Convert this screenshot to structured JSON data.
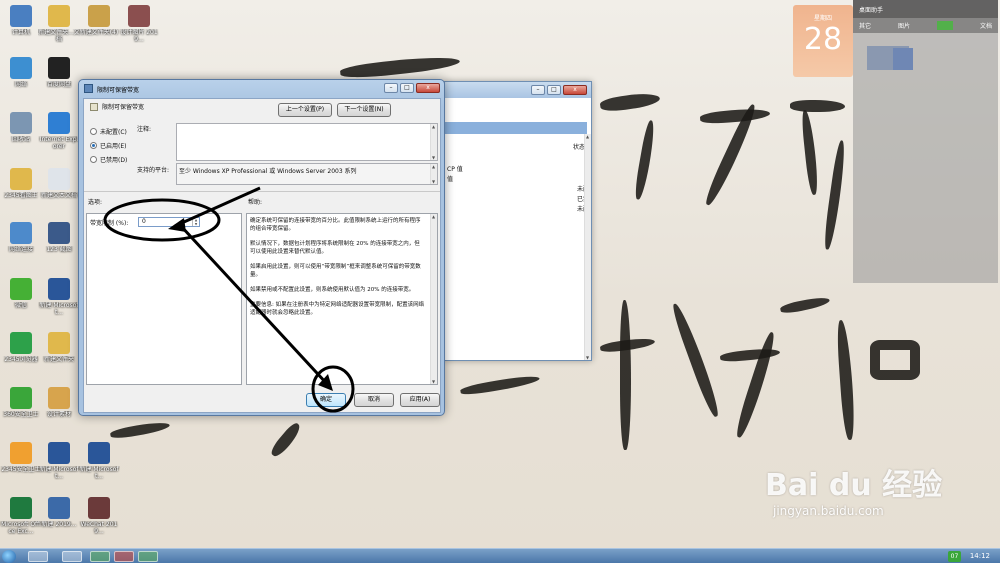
{
  "desktop": {
    "icons": [
      {
        "label": "计算机",
        "icon": "computer-icon",
        "color": "#4a7fc1"
      },
      {
        "label": "新建文件夹...文档",
        "icon": "folder-icon",
        "color": "#e0b84c"
      },
      {
        "label": "新建文件夹(4)",
        "icon": "folder-icon",
        "color": "#caa14a"
      },
      {
        "label": "设计图片 2019...",
        "icon": "image-icon",
        "color": "#8b4f4f"
      },
      {
        "label": "网络",
        "icon": "network-icon",
        "color": "#3d8fd1"
      },
      {
        "label": "百度网盘",
        "icon": "app-icon",
        "color": "#222222"
      },
      {
        "label": "回收站",
        "icon": "recycle-bin-icon",
        "color": "#7c96b2"
      },
      {
        "label": "Internet Explorer",
        "icon": "ie-icon",
        "color": "#2f7fd3"
      },
      {
        "label": "2345看图王",
        "icon": "folder-icon",
        "color": "#e0b84c"
      },
      {
        "label": "新建文本文档",
        "icon": "text-file-icon",
        "color": "#dfe4ea"
      },
      {
        "label": "网络连接",
        "icon": "network-icon",
        "color": "#4d8acb"
      },
      {
        "label": "123 截图",
        "icon": "image-icon",
        "color": "#3b5a8a"
      },
      {
        "label": "微信",
        "icon": "wechat-icon",
        "color": "#45b035"
      },
      {
        "label": "新建 Microsoft...",
        "icon": "word-icon",
        "color": "#2a5699"
      },
      {
        "label": "2345浏览器",
        "icon": "browser-icon",
        "color": "#2da14a"
      },
      {
        "label": "新建文件夹",
        "icon": "folder-icon",
        "color": "#e0b84c"
      },
      {
        "label": "360安全卫士",
        "icon": "shield-icon",
        "color": "#3aa63a"
      },
      {
        "label": "设计素材",
        "icon": "folder-icon",
        "color": "#d7a44d"
      },
      {
        "label": "2345安全卫士",
        "icon": "app-icon",
        "color": "#f0a030"
      },
      {
        "label": "新建 Microsoft...",
        "icon": "word-icon",
        "color": "#2a5699"
      },
      {
        "label": "新建 Microsoft...",
        "icon": "word-icon",
        "color": "#2a5699"
      },
      {
        "label": "Microsoft Office Exc...",
        "icon": "excel-icon",
        "color": "#1f7a3f"
      },
      {
        "label": "新建 2019...",
        "icon": "word-icon",
        "color": "#3c6aa8"
      },
      {
        "label": "WeChat 2019...",
        "icon": "image-icon",
        "color": "#6b3a3a"
      }
    ]
  },
  "calendar": {
    "month": "星期四",
    "day": "28"
  },
  "assistant": {
    "title": "桌面助手",
    "tabs": [
      "其它",
      "图片",
      "",
      "文档"
    ],
    "active_tab": "图片"
  },
  "taskbar": {
    "clock": "14:12",
    "tray_badge": "07"
  },
  "background_window": {
    "rows": [
      {
        "left": "CP 值",
        "right": ""
      },
      {
        "left": "值",
        "right": ""
      },
      {
        "left": "",
        "right": "未配"
      },
      {
        "left": "",
        "right": "已禁"
      },
      {
        "left": "",
        "right": "未配"
      }
    ],
    "header_right": "状态"
  },
  "dialog": {
    "title": "限制可保留带宽",
    "subtitle": "限制可保留带宽",
    "prev_button": "上一个设置(P)",
    "next_button": "下一个设置(N)",
    "radios": [
      "未配置(C)",
      "已启用(E)",
      "已禁用(D)"
    ],
    "selected_radio": 1,
    "comment_label": "注释:",
    "platform_label": "支持的平台:",
    "platform_value": "至少 Windows XP Professional 或 Windows Server 2003 系列",
    "options_label": "选项:",
    "help_label": "帮助:",
    "bandwidth_label": "带宽限制 (%):",
    "bandwidth_value": "0",
    "help_paragraphs": [
      "确定系统可保留的连接带宽的百分比。此值限制系统上运行的所有程序的组合带宽保留。",
      "默认情况下，数据包计划程序将系统限制在 20% 的连接带宽之内，但可以使用此设置来替代默认值。",
      "如果启用此设置，则可以使用“带宽限制”框来调整系统可保留的带宽数量。",
      "如果禁用或不配置此设置，则系统使用默认值为 20% 的连接带宽。",
      "重要信息: 如果在注册表中为特定网络适配器设置带宽限制，配置该网络适配器时就会忽略此设置。"
    ],
    "ok_button": "确定",
    "cancel_button": "取消",
    "apply_button": "应用(A)"
  },
  "watermark": {
    "logo": "Bai du 经验",
    "url": "jingyan.baidu.com"
  }
}
